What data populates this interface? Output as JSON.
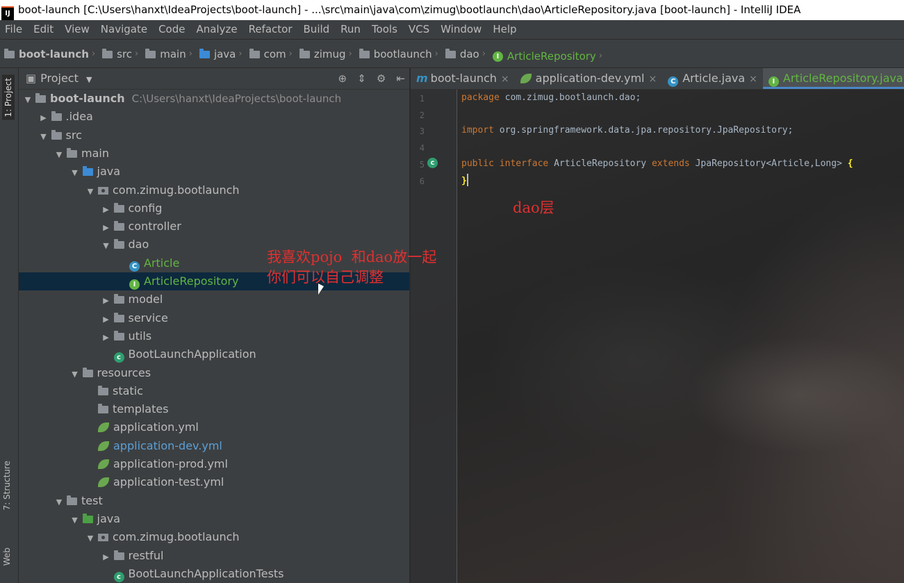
{
  "window": {
    "title": "boot-launch [C:\\Users\\hanxt\\IdeaProjects\\boot-launch] - ...\\src\\main\\java\\com\\zimug\\bootlaunch\\dao\\ArticleRepository.java [boot-launch] - IntelliJ IDEA"
  },
  "menu": [
    "File",
    "Edit",
    "View",
    "Navigate",
    "Code",
    "Analyze",
    "Refactor",
    "Build",
    "Run",
    "Tools",
    "VCS",
    "Window",
    "Help"
  ],
  "breadcrumb": [
    "boot-launch",
    "src",
    "main",
    "java",
    "com",
    "zimug",
    "bootlaunch",
    "dao",
    "ArticleRepository"
  ],
  "side_tabs": {
    "project": "1: Project",
    "structure": "7: Structure",
    "web": "Web"
  },
  "project_panel": {
    "title": "Project"
  },
  "tree": [
    {
      "label": "boot-launch",
      "path": "C:\\Users\\hanxt\\IdeaProjects\\boot-launch",
      "indent": 0,
      "arrow": "down",
      "icon": "module"
    },
    {
      "label": ".idea",
      "indent": 1,
      "arrow": "right",
      "icon": "folder"
    },
    {
      "label": "src",
      "indent": 1,
      "arrow": "down",
      "icon": "folder"
    },
    {
      "label": "main",
      "indent": 2,
      "arrow": "down",
      "icon": "folder"
    },
    {
      "label": "java",
      "indent": 3,
      "arrow": "down",
      "icon": "folder-blue"
    },
    {
      "label": "com.zimug.bootlaunch",
      "indent": 4,
      "arrow": "down",
      "icon": "package"
    },
    {
      "label": "config",
      "indent": 5,
      "arrow": "right",
      "icon": "folder"
    },
    {
      "label": "controller",
      "indent": 5,
      "arrow": "right",
      "icon": "folder"
    },
    {
      "label": "dao",
      "indent": 5,
      "arrow": "down",
      "icon": "folder"
    },
    {
      "label": "Article",
      "indent": 6,
      "arrow": "none",
      "icon": "class",
      "color": "green"
    },
    {
      "label": "ArticleRepository",
      "indent": 6,
      "arrow": "none",
      "icon": "interface",
      "color": "green",
      "selected": true
    },
    {
      "label": "model",
      "indent": 5,
      "arrow": "right",
      "icon": "folder"
    },
    {
      "label": "service",
      "indent": 5,
      "arrow": "right",
      "icon": "folder"
    },
    {
      "label": "utils",
      "indent": 5,
      "arrow": "right",
      "icon": "folder"
    },
    {
      "label": "BootLaunchApplication",
      "indent": 5,
      "arrow": "none",
      "icon": "spring-class"
    },
    {
      "label": "resources",
      "indent": 3,
      "arrow": "down",
      "icon": "folder-res"
    },
    {
      "label": "static",
      "indent": 4,
      "arrow": "none",
      "icon": "folder"
    },
    {
      "label": "templates",
      "indent": 4,
      "arrow": "none",
      "icon": "folder"
    },
    {
      "label": "application.yml",
      "indent": 4,
      "arrow": "none",
      "icon": "spring-leaf"
    },
    {
      "label": "application-dev.yml",
      "indent": 4,
      "arrow": "none",
      "icon": "spring-leaf",
      "color": "blue"
    },
    {
      "label": "application-prod.yml",
      "indent": 4,
      "arrow": "none",
      "icon": "spring-leaf"
    },
    {
      "label": "application-test.yml",
      "indent": 4,
      "arrow": "none",
      "icon": "spring-leaf"
    },
    {
      "label": "test",
      "indent": 2,
      "arrow": "down",
      "icon": "folder"
    },
    {
      "label": "java",
      "indent": 3,
      "arrow": "down",
      "icon": "folder-green"
    },
    {
      "label": "com.zimug.bootlaunch",
      "indent": 4,
      "arrow": "down",
      "icon": "package"
    },
    {
      "label": "restful",
      "indent": 5,
      "arrow": "right",
      "icon": "folder"
    },
    {
      "label": "BootLaunchApplicationTests",
      "indent": 5,
      "arrow": "none",
      "icon": "spring-class"
    }
  ],
  "editor_tabs": [
    {
      "label": "boot-launch",
      "icon": "m",
      "active": false
    },
    {
      "label": "application-dev.yml",
      "icon": "spring-leaf",
      "active": false
    },
    {
      "label": "Article.java",
      "icon": "class",
      "active": false
    },
    {
      "label": "ArticleRepository.java",
      "icon": "interface",
      "active": true
    }
  ],
  "code": {
    "line_numbers": [
      "1",
      "2",
      "3",
      "4",
      "5",
      "6"
    ],
    "line1": {
      "kw": "package",
      "rest": " com.zimug.bootlaunch.dao;"
    },
    "line3": {
      "kw": "import",
      "rest": " org.springframework.data.jpa.repository.JpaRepository;"
    },
    "line5": {
      "kw1": "public",
      "kw2": "interface",
      "name": " ArticleRepository ",
      "kw3": "extends",
      "rest": " JpaRepository<Article,Long> ",
      "brace": "{"
    },
    "line6": {
      "brace": "}"
    }
  },
  "annotations": {
    "dao_label": "dao层",
    "note_line1": "我喜欢pojo  和dao放一起",
    "note_line2": "你们可以自己调整"
  }
}
